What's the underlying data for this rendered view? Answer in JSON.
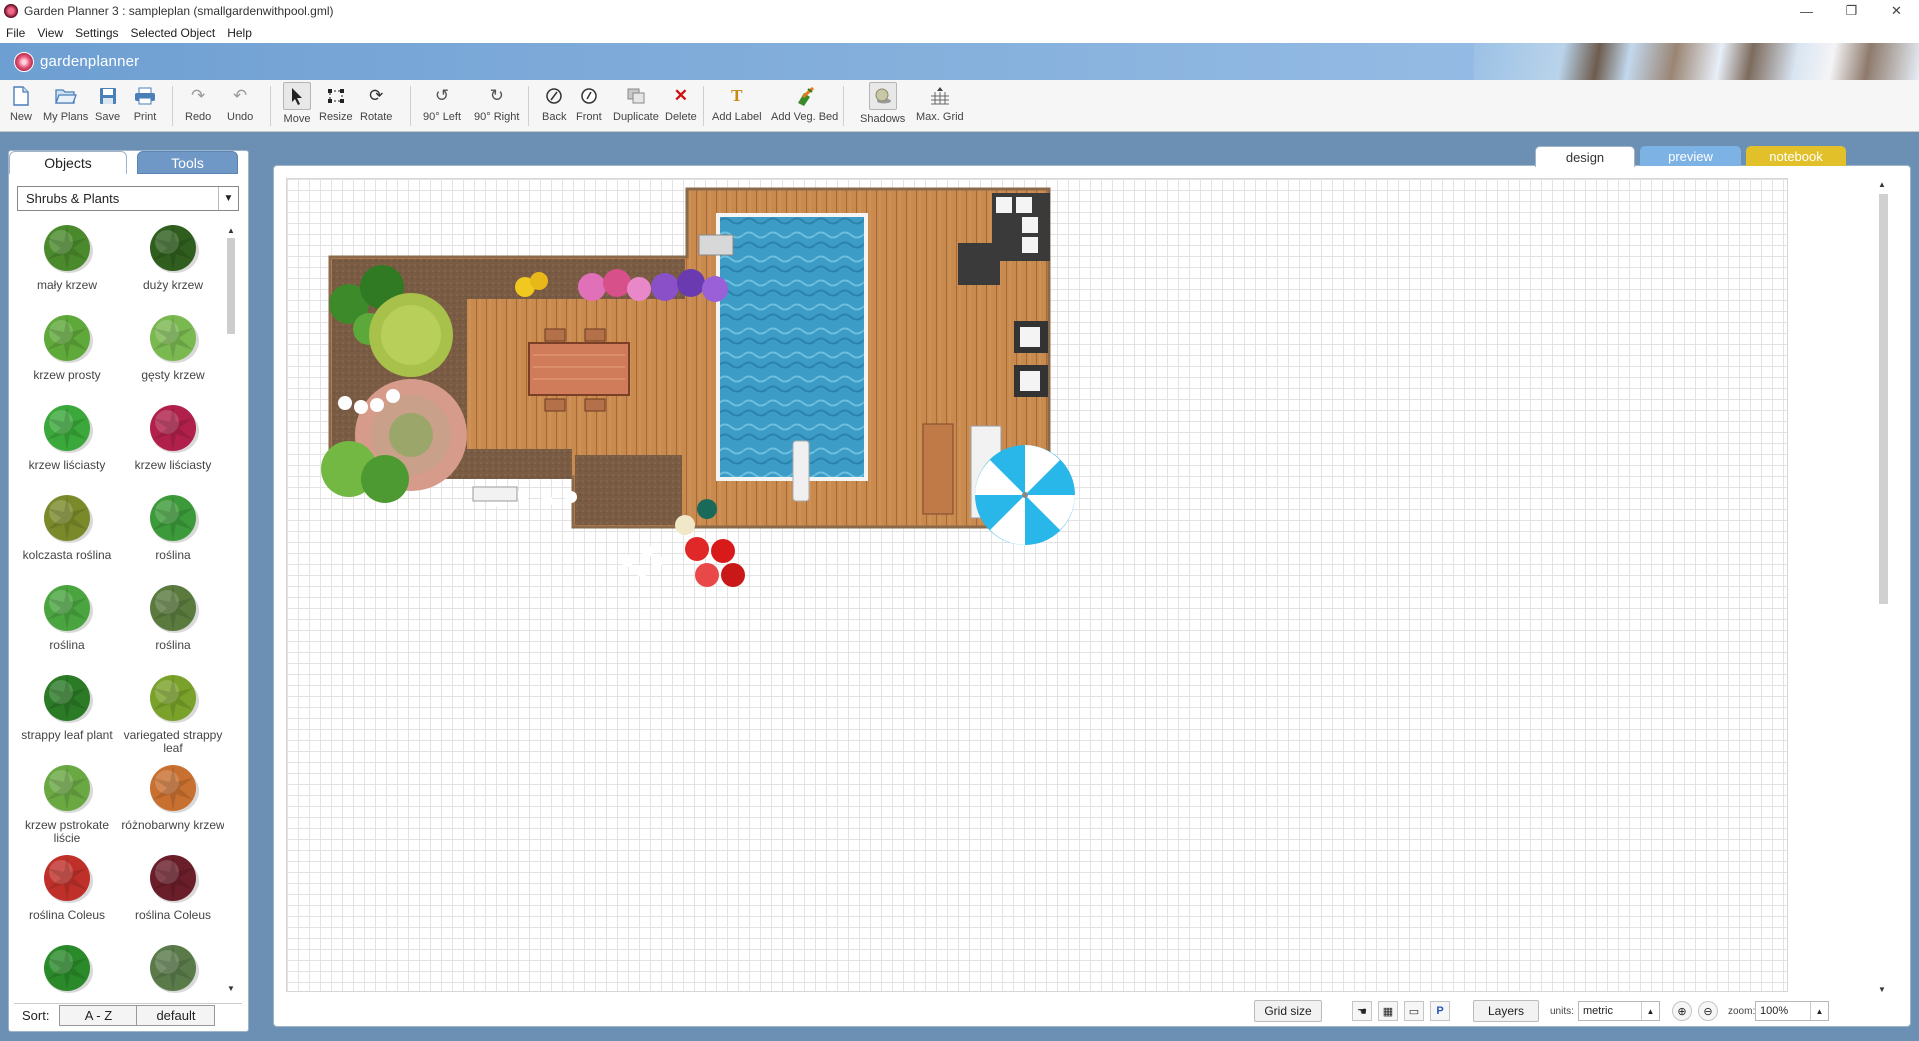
{
  "window": {
    "title": "Garden Planner 3 : sampleplan (smallgardenwithpool.gml)",
    "minimize": "—",
    "maximize": "❐",
    "close": "✕"
  },
  "menu": [
    "File",
    "View",
    "Settings",
    "Selected Object",
    "Help"
  ],
  "brand": {
    "name": "gardenplanner"
  },
  "toolbar": {
    "new": "New",
    "my_plans": "My Plans",
    "save": "Save",
    "print": "Print",
    "redo": "Redo",
    "undo": "Undo",
    "move": "Move",
    "resize": "Resize",
    "rotate": "Rotate",
    "rot_left": "90° Left",
    "rot_right": "90° Right",
    "back": "Back",
    "front": "Front",
    "duplicate": "Duplicate",
    "delete": "Delete",
    "add_label": "Add Label",
    "add_veg_bed": "Add Veg. Bed",
    "shadows": "Shadows",
    "max_grid": "Max. Grid"
  },
  "panel_tabs": {
    "objects": "Objects",
    "tools": "Tools"
  },
  "category": {
    "selected": "Shrubs & Plants"
  },
  "objects": [
    {
      "name": "mały krzew",
      "icon": "small-shrub",
      "color": "#4a8a2c"
    },
    {
      "name": "duży krzew",
      "icon": "large-shrub",
      "color": "#2f5e1e"
    },
    {
      "name": "krzew prosty",
      "icon": "simple-shrub",
      "color": "#5fa83a"
    },
    {
      "name": "gęsty krzew",
      "icon": "dense-shrub",
      "color": "#7ab850"
    },
    {
      "name": "krzew liściasty",
      "icon": "leafy-shrub-green",
      "color": "#3aa83a"
    },
    {
      "name": "krzew liściasty",
      "icon": "leafy-shrub-red",
      "color": "#b0204a"
    },
    {
      "name": "kolczasta roślina",
      "icon": "spiky-plant",
      "color": "#7a8a2a"
    },
    {
      "name": "roślina",
      "icon": "plant-star",
      "color": "#3c9a3a"
    },
    {
      "name": "roślina",
      "icon": "plant-rosette",
      "color": "#4aa540"
    },
    {
      "name": "roślina",
      "icon": "plant-dark-rosette",
      "color": "#5a7a3e"
    },
    {
      "name": "strappy leaf plant",
      "icon": "strappy-leaf",
      "color": "#2a7a26"
    },
    {
      "name": "variegated strappy leaf",
      "icon": "variegated-strappy-leaf",
      "color": "#7aa22a"
    },
    {
      "name": "krzew pstrokate liście",
      "icon": "variegated-leaf-shrub",
      "color": "#6aa842"
    },
    {
      "name": "różnobarwny krzew",
      "icon": "multicolor-shrub",
      "color": "#c87030"
    },
    {
      "name": "roślina Coleus",
      "icon": "coleus-red",
      "color": "#c0302a"
    },
    {
      "name": "roślina Coleus",
      "icon": "coleus-dark",
      "color": "#6a1e2a"
    },
    {
      "name": "",
      "icon": "fern-green",
      "color": "#2a8a2a"
    },
    {
      "name": "",
      "icon": "fern-grey",
      "color": "#5a7a4a"
    }
  ],
  "sort": {
    "label": "Sort:",
    "az": "A - Z",
    "default": "default"
  },
  "view_tabs": {
    "design": "design",
    "preview": "preview",
    "notebook": "notebook"
  },
  "statusbar": {
    "grid_size": "Grid size",
    "layers": "Layers",
    "units_label": "units:",
    "units_value": "metric",
    "zoom_label": "zoom:",
    "zoom_value": "100%"
  }
}
